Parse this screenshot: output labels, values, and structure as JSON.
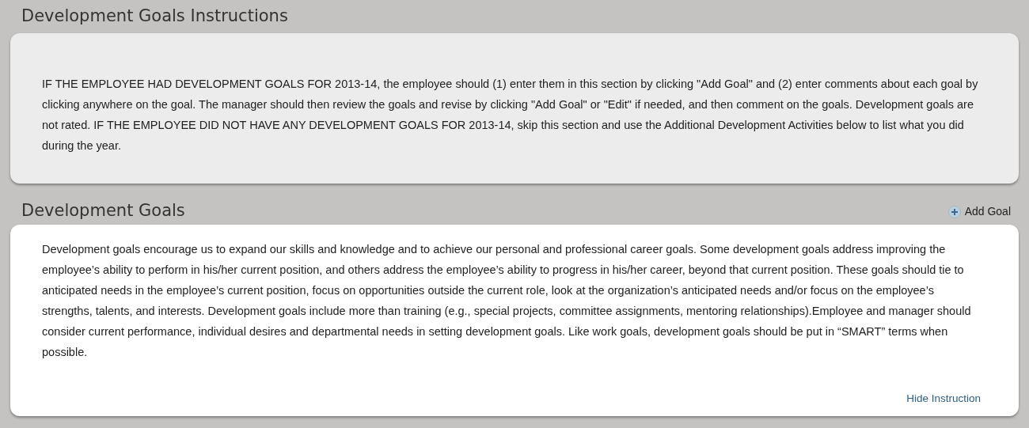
{
  "instructions": {
    "title": "Development Goals Instructions",
    "text": "IF THE EMPLOYEE HAD DEVELOPMENT GOALS FOR 2013-14, the employee should (1) enter them in this section by clicking \"Add Goal\" and (2) enter comments about each goal by clicking anywhere on the goal. The manager should then review the goals and revise by clicking \"Add Goal\" or \"Edit\" if needed, and then comment on the goals. Development goals are not rated. IF THE EMPLOYEE DID NOT HAVE ANY DEVELOPMENT GOALS FOR 2013-14, skip this section and use the Additional Development Activities below to list what you did during the year."
  },
  "goals": {
    "title": "Development Goals",
    "add_button": "Add Goal",
    "text": "Development goals encourage us to expand our skills and knowledge and to achieve our personal and professional career goals. Some development goals address improving the employee’s ability to perform in his/her current position, and others address the employee’s ability to progress in his/her career, beyond that current position. These goals should tie to anticipated needs in the employee’s current position, focus on opportunities outside the current role, look at the organization’s anticipated needs and/or focus on the employee’s strengths, talents, and interests. Development goals include more than training (e.g., special projects, committee assignments, mentoring relationships).Employee and manager should consider current performance, individual desires and departmental needs in setting development goals. Like work goals, development goals should be put in “SMART” terms when possible.",
    "hide_link": "Hide Instruction"
  }
}
